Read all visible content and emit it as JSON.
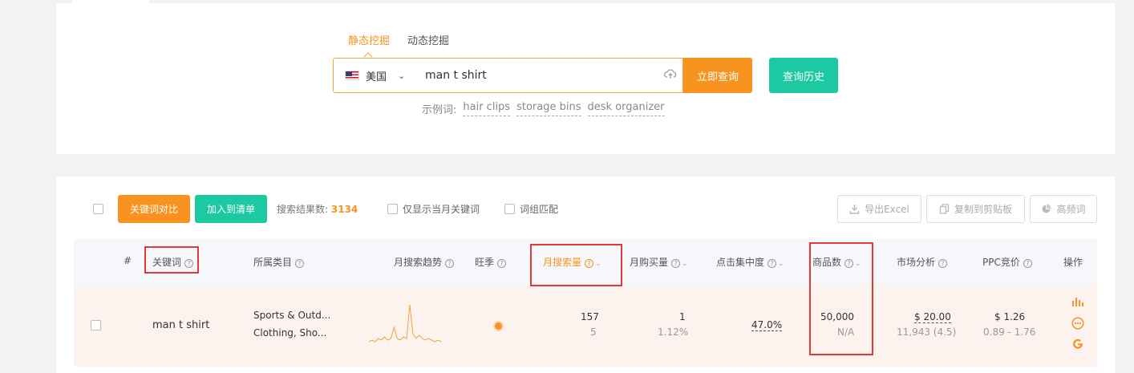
{
  "search": {
    "tabs": [
      "静态挖掘",
      "动态挖掘"
    ],
    "active_tab": 0,
    "country": "美国",
    "keyword": "man t shirt",
    "query_button": "立即查询",
    "history_button": "查询历史",
    "examples_label": "示例词:",
    "examples": [
      "hair clips",
      "storage bins",
      "desk organizer"
    ]
  },
  "toolbar": {
    "compare_button": "关键词对比",
    "add_list_button": "加入到清单",
    "result_count_label": "搜索结果数:",
    "result_count": "3134",
    "option_current_month": "仅显示当月关键词",
    "option_phrase_match": "词组匹配",
    "export_button": "导出Excel",
    "copy_button": "复制到剪贴板",
    "freq_button": "高频词"
  },
  "table": {
    "headers": {
      "index": "#",
      "keyword": "关键词",
      "category": "所属类目",
      "trend": "月搜索趋势",
      "season": "旺季",
      "monthly_search": "月搜索量",
      "monthly_purchase": "月购买量",
      "click_concentration": "点击集中度",
      "product_count": "商品数",
      "market_analysis": "市场分析",
      "ppc": "PPC竞价",
      "actions": "操作"
    },
    "rows": [
      {
        "keyword": "man t shirt",
        "category_1": "Sports & Outd...",
        "category_2": "Clothing, Sho...",
        "monthly_search": "157",
        "monthly_search_rank": "5",
        "monthly_purchase": "1",
        "purchase_rate": "1.12%",
        "click_concentration": "47.0%",
        "product_count": "50,000",
        "product_count_sub": "N/A",
        "market_currency": "$",
        "market_price": "20.00",
        "market_reviews": "11,943 (4.5)",
        "ppc_currency": "$",
        "ppc_bid": "1.26",
        "ppc_range": "0.89 - 1.76",
        "trend": [
          3,
          4,
          3,
          5,
          4,
          6,
          4,
          5,
          12,
          5,
          4,
          6,
          5,
          26,
          8,
          5,
          7,
          5,
          4,
          5,
          4,
          3,
          4,
          3
        ]
      }
    ]
  },
  "colors": {
    "orange": "#f7931e",
    "teal": "#1cc9a3",
    "highlight_red": "#e03a3a"
  }
}
